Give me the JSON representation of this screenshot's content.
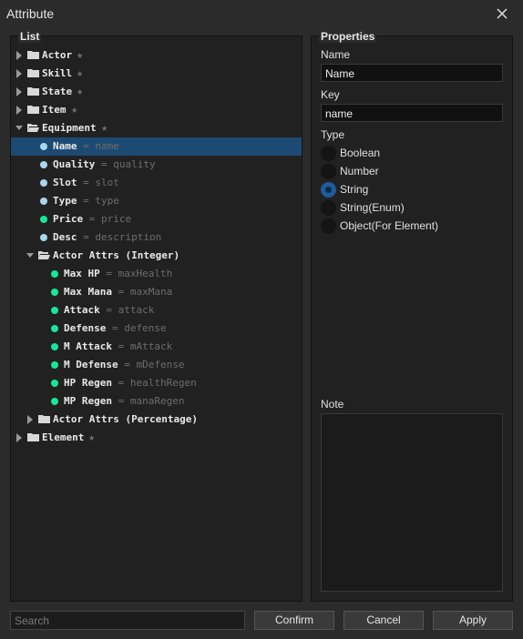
{
  "window": {
    "title": "Attribute"
  },
  "list_panel": {
    "title": "List"
  },
  "properties_panel": {
    "title": "Properties"
  },
  "colors": {
    "accent": "#1d4a72",
    "dot_light": "#a9d6ea",
    "dot_green": "#19e69a"
  },
  "tree": [
    {
      "label": "Actor",
      "key": "",
      "type": "folder",
      "expanded": false,
      "starred": true
    },
    {
      "label": "Skill",
      "key": "",
      "type": "folder",
      "expanded": false,
      "starred": true
    },
    {
      "label": "State",
      "key": "",
      "type": "folder",
      "expanded": false,
      "starred": true
    },
    {
      "label": "Item",
      "key": "",
      "type": "folder",
      "expanded": false,
      "starred": true
    },
    {
      "label": "Equipment",
      "key": "",
      "type": "folder",
      "expanded": true,
      "starred": true
    },
    {
      "label": "Name",
      "key": "= name",
      "type": "attr",
      "dot": "light",
      "selected": true
    },
    {
      "label": "Quality",
      "key": "= quality",
      "type": "attr",
      "dot": "light"
    },
    {
      "label": "Slot",
      "key": "= slot",
      "type": "attr",
      "dot": "light"
    },
    {
      "label": "Type",
      "key": "= type",
      "type": "attr",
      "dot": "light"
    },
    {
      "label": "Price",
      "key": "= price",
      "type": "attr",
      "dot": "green"
    },
    {
      "label": "Desc",
      "key": "= description",
      "type": "attr",
      "dot": "light"
    },
    {
      "label": "Actor Attrs (Integer)",
      "key": "",
      "type": "folder",
      "expanded": true,
      "starred": false
    },
    {
      "label": "Max HP",
      "key": "= maxHealth",
      "type": "attr",
      "dot": "green"
    },
    {
      "label": "Max Mana",
      "key": "= maxMana",
      "type": "attr",
      "dot": "green"
    },
    {
      "label": "Attack",
      "key": "= attack",
      "type": "attr",
      "dot": "green"
    },
    {
      "label": "Defense",
      "key": "= defense",
      "type": "attr",
      "dot": "green"
    },
    {
      "label": "M Attack",
      "key": "= mAttack",
      "type": "attr",
      "dot": "green"
    },
    {
      "label": "M Defense",
      "key": "= mDefense",
      "type": "attr",
      "dot": "green"
    },
    {
      "label": "HP Regen",
      "key": "= healthRegen",
      "type": "attr",
      "dot": "green"
    },
    {
      "label": "MP Regen",
      "key": "= manaRegen",
      "type": "attr",
      "dot": "green"
    },
    {
      "label": "Actor Attrs (Percentage)",
      "key": "",
      "type": "folder",
      "expanded": false,
      "starred": false
    },
    {
      "label": "Element",
      "key": "",
      "type": "folder",
      "expanded": false,
      "starred": true
    }
  ],
  "properties": {
    "name_label": "Name",
    "name_value": "Name",
    "key_label": "Key",
    "key_value": "name",
    "type_label": "Type",
    "types": [
      {
        "label": "Boolean",
        "checked": false
      },
      {
        "label": "Number",
        "checked": false
      },
      {
        "label": "String",
        "checked": true
      },
      {
        "label": "String(Enum)",
        "checked": false
      },
      {
        "label": "Object(For Element)",
        "checked": false
      }
    ],
    "note_label": "Note",
    "note_value": ""
  },
  "footer": {
    "search_placeholder": "Search",
    "confirm": "Confirm",
    "cancel": "Cancel",
    "apply": "Apply"
  }
}
